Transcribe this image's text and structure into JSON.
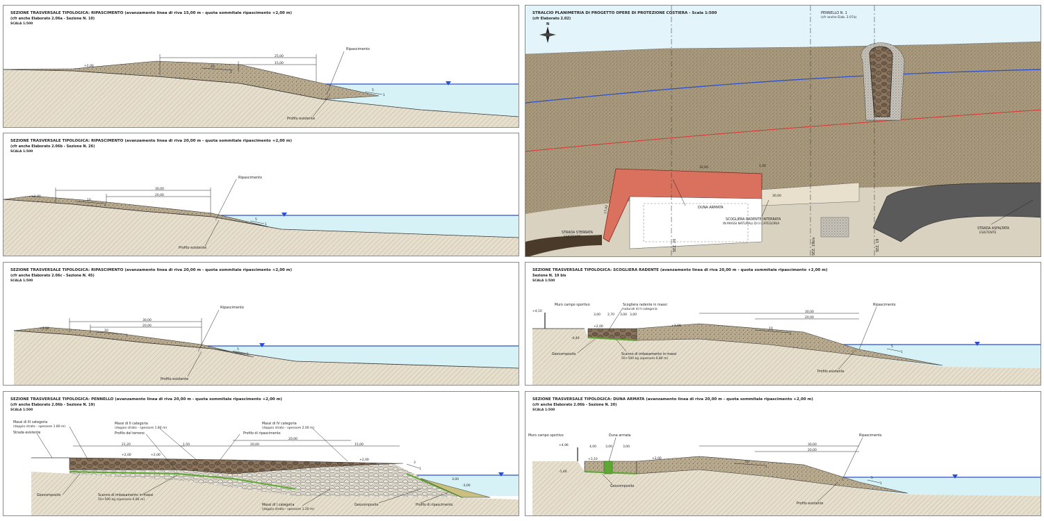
{
  "colors": {
    "water": "#d6f2f6",
    "water_line": "#2a4fd0",
    "sand": "#b5a78c",
    "sand_dark": "#8c7c60",
    "ground": "#d9d2c0",
    "rock": "#7a6450",
    "geotextile": "#5ca832",
    "dune_red": "#d9715e",
    "asphalt": "#5a5a5a",
    "profile_red": "#e03030"
  },
  "panels": {
    "p1": {
      "title": "SEZIONE TRASVERSALE TIPOLOGICA: RIPASCIMENTO (avanzamento linea di riva 15,00 m - quota sommitale ripascimento +2,00 m)",
      "subtitle": "(cfr anche Elaborato 2.06a - Sezione N. 10)",
      "scale": "SCALA 1:500",
      "lbl_rip": "Ripascimento",
      "lbl_prof": "Profilo esistente",
      "elev": "+2,00",
      "dim1": "25,00",
      "dim2": "15,00",
      "slope1": "10",
      "slope1b": "1",
      "slope2": "5",
      "slope2b": "1"
    },
    "p2": {
      "title": "SEZIONE TRASVERSALE TIPOLOGICA: RIPASCIMENTO (avanzamento linea di riva 20,00 m - quota sommitale ripascimento +2,00 m)",
      "subtitle": "(cfr anche Elaborato 2.06b - Sezione N. 26)",
      "scale": "SCALA 1:500",
      "lbl_rip": "Ripascimento",
      "lbl_prof": "Profilo esistente",
      "elev": "+2,00",
      "dim1": "30,00",
      "dim2": "20,00",
      "slope1": "10",
      "slope1b": "1",
      "slope2": "5",
      "slope2b": "1"
    },
    "p3": {
      "title": "SEZIONE TRASVERSALE TIPOLOGICA: RIPASCIMENTO (avanzamento linea di riva 20,00 m - quota sommitale ripascimento +2,00 m)",
      "subtitle": "(cfr anche Elaborato 2.06c - Sezione N. 45)",
      "scale": "SCALA 1:500",
      "lbl_rip": "Ripascimento",
      "lbl_prof": "Profilo esistente",
      "elev": "+2,00",
      "dim1": "30,00",
      "dim2": "20,00",
      "slope1": "10",
      "slope1b": "1",
      "slope2": "5",
      "slope2b": "1"
    },
    "p4": {
      "title": "SEZIONE TRASVERSALE TIPOLOGICA: PENNELLO (avanzamento linea di riva 20,00 m - quota sommitale ripascimento +2,00 m)",
      "subtitle": "(cfr anche Elaborato 2.06b - Sezione N. 19)",
      "scale": "SCALA 1:500",
      "lbl_m3": "Massi di III categoria",
      "lbl_m3b": "(doppio strato - spessore 1.80 m)",
      "lbl_strada": "Strada esistente",
      "lbl_m2": "Massi di II categoria",
      "lbl_m2b": "(doppio strato - spessore 1.80 m)",
      "lbl_terr": "Profilo del terreno",
      "lbl_m4": "Massi di IV categoria",
      "lbl_m4b": "(doppio strato - spessore 2.00 m)",
      "lbl_profrip": "Profilo di ripascimento",
      "lbl_geo1": "Geocomposito",
      "lbl_scanno": "Scanno di imbasamento in massi",
      "lbl_scannob": "50÷500 kg (spessore 0,80 m)",
      "lbl_m1": "Massi di I categoria",
      "lbl_m1b": "(doppio strato - spessore 1.20 m)",
      "lbl_geo2": "Geocomposito",
      "lbl_profrip2": "Profilo di ripascimento",
      "dim_a": "21,20",
      "dim_b": "1,50",
      "dim_c": "20,00",
      "dim_d": "15,00",
      "dim_e": "20,00",
      "elev1": "+2,00",
      "elev2": "+2,00",
      "elev3": "+2,00",
      "elev4": "-3,00",
      "slope": "3",
      "slopeb": "1",
      "slope2": "3,00"
    },
    "p5": {
      "title": "STRALCIO PLANIMETRIA DI PROGETTO OPERE DI PROTEZIONE COSTIERA - Scala 1:500",
      "subtitle": "(cfr Elaborato 2.02)",
      "lbl_penn": "PENNELLO N. 1",
      "lbl_penn2": "(cfr anche Elab. 2.07a)",
      "lbl_duna": "DUNA ARMATA",
      "lbl_scogliera": "SCOGLIERA RADENTE INTERRATA",
      "lbl_scogliera2": "IN MASSI NATURALI DI II CATEGORIA",
      "lbl_sterrata": "STRADA STERRATA",
      "lbl_sterrata2": "ESISTENTE",
      "lbl_asfaltata": "STRADA ASFALTATA",
      "lbl_asfaltata2": "ESISTENTE",
      "sez20": "SEZ. 20",
      "sez19bis": "SEZ. 19bis",
      "sez19": "SEZ. 19",
      "dim1": "32,00",
      "dim2": "30,00",
      "dim3": "1,00",
      "dim4": "17,42",
      "north": "N"
    },
    "p6": {
      "title": "SEZIONE TRASVERSALE TIPOLOGICA: SCOGLIERA RADENTE (avanzamento linea di riva 20,00 m - quota sommitale ripascimento +2,00 m)",
      "subtitle": "Sezione N. 19 bis",
      "scale": "SCALA 1:500",
      "lbl_muro": "Muro campo sportivo",
      "lbl_scog": "Scogliera radente in massi",
      "lbl_scog2": "naturali di II categoria",
      "lbl_rip": "Ripascimento",
      "lbl_geo": "Geocomposito",
      "lbl_scanno": "Scanno di imbasamento in massi",
      "lbl_scanno2": "50÷500 kg (spessore 0,80 m)",
      "lbl_prof": "Profilo esistente",
      "elev1": "+4,10",
      "elev2": "+2,00",
      "elev3": "+2,00",
      "elev4": "-0,40",
      "dim1": "3,00",
      "dim2": "2,70",
      "dim3": "3,00",
      "dim4": "3,00",
      "dim5": "30,00",
      "dim6": "20,00",
      "slope1": "10",
      "slope1b": "1",
      "slope2": "5",
      "slope2b": "1"
    },
    "p7": {
      "title": "SEZIONE TRASVERSALE TIPOLOGICA: DUNA ARMATA (avanzamento linea di riva 20,00 m - quota sommitale ripascimento +2,00 m)",
      "subtitle": "(cfr anche Elaborato 2.06b - Sezione N. 20)",
      "scale": "SCALA 1:500",
      "lbl_muro": "Muro campo sportivo",
      "lbl_duna": "Duna armata",
      "lbl_rip": "Ripascimento",
      "lbl_geo": "Geocomposito",
      "lbl_prof": "Profilo esistente",
      "elev1": "+4,96",
      "elev2": "+3,10",
      "elev3": "+2,00",
      "elev4": "-1,46",
      "dim1": "4,00",
      "dim2": "3,00",
      "dim3": "3,00",
      "dim4": "30,00",
      "dim5": "20,00",
      "slope1": "10",
      "slope1b": "1",
      "slope2": "5",
      "slope2b": "1"
    }
  }
}
